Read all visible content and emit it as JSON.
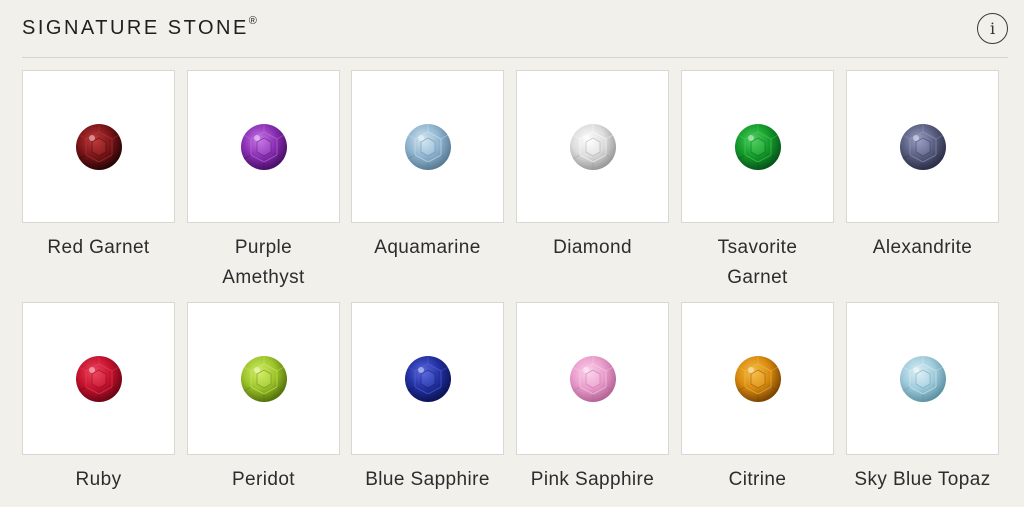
{
  "header": {
    "title": "SIGNATURE STONE",
    "trademark": "®",
    "info_label": "i",
    "info_icon": "info-circle-icon"
  },
  "stones": [
    {
      "label": "Red Garnet",
      "lines": [
        "Red Garnet"
      ],
      "color": "#7a1518",
      "highlight": "#c0393b",
      "shadow": "#2a0506"
    },
    {
      "label": "Purple Amethyst",
      "lines": [
        "Purple",
        "Amethyst"
      ],
      "color": "#8a2fb3",
      "highlight": "#c977e8",
      "shadow": "#4a106a"
    },
    {
      "label": "Aquamarine",
      "lines": [
        "Aquamarine"
      ],
      "color": "#8fb4cf",
      "highlight": "#d3e6f2",
      "shadow": "#5a7c96"
    },
    {
      "label": "Diamond",
      "lines": [
        "Diamond"
      ],
      "color": "#dcdcdc",
      "highlight": "#ffffff",
      "shadow": "#9a9a9a"
    },
    {
      "label": "Tsavorite Garnet",
      "lines": [
        "Tsavorite",
        "Garnet"
      ],
      "color": "#149a2a",
      "highlight": "#4fd160",
      "shadow": "#06561a"
    },
    {
      "label": "Alexandrite",
      "lines": [
        "Alexandrite"
      ],
      "color": "#5a5f80",
      "highlight": "#9aa0c6",
      "shadow": "#2c2f48"
    },
    {
      "label": "Ruby",
      "lines": [
        "Ruby"
      ],
      "color": "#c4122e",
      "highlight": "#f0465e",
      "shadow": "#6e0515"
    },
    {
      "label": "Peridot",
      "lines": [
        "Peridot"
      ],
      "color": "#9cc42a",
      "highlight": "#d3ef6a",
      "shadow": "#55730c"
    },
    {
      "label": "Blue Sapphire",
      "lines": [
        "Blue Sapphire"
      ],
      "color": "#2230a0",
      "highlight": "#5a6ae0",
      "shadow": "#0c1458"
    },
    {
      "label": "Pink Sapphire",
      "lines": [
        "Pink Sapphire"
      ],
      "color": "#e99ccb",
      "highlight": "#fbd3ec",
      "shadow": "#b56596"
    },
    {
      "label": "Citrine",
      "lines": [
        "Citrine"
      ],
      "color": "#d98a0e",
      "highlight": "#f6c04a",
      "shadow": "#7c4604"
    },
    {
      "label": "Sky Blue Topaz",
      "lines": [
        "Sky Blue Topaz"
      ],
      "color": "#9fcbdc",
      "highlight": "#dff0f6",
      "shadow": "#5e93a6"
    }
  ]
}
